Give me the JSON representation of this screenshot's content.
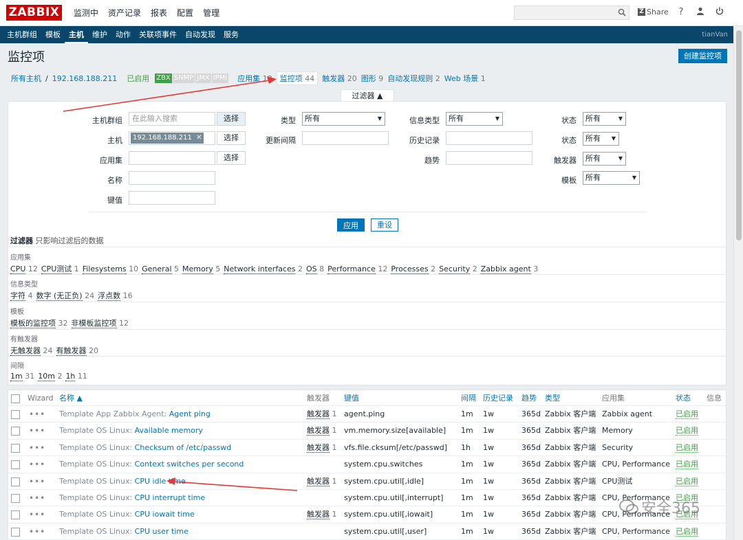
{
  "header": {
    "logo": "ZABBIX",
    "menu": [
      "监测中",
      "资产记录",
      "报表",
      "配置",
      "管理"
    ],
    "selected": "配置",
    "share": "Share",
    "help": "?",
    "user_icon": "user-icon",
    "power_icon": "power-icon"
  },
  "submenu": {
    "items": [
      "主机群组",
      "模板",
      "主机",
      "维护",
      "动作",
      "关联项事件",
      "自动发现",
      "服务"
    ],
    "selected": "主机",
    "user": "tianVan"
  },
  "page": {
    "title": "监控项",
    "create_button": "创建监控项"
  },
  "breadcrumbs": {
    "all_hosts": "所有主机",
    "sep": "/",
    "host": "192.168.188.211",
    "enabled": "已启用",
    "badges": [
      "ZBX",
      "SNMP",
      "JMX",
      "IPMI"
    ],
    "tabs": [
      {
        "label": "应用集",
        "count": "13"
      },
      {
        "label": "监控项",
        "count": "44"
      },
      {
        "label": "触发器",
        "count": "20"
      },
      {
        "label": "图形",
        "count": "9"
      },
      {
        "label": "自动发现规则",
        "count": "2"
      },
      {
        "label": "Web 场景",
        "count": "1"
      }
    ]
  },
  "filter": {
    "tab_label": "过滤器 ▲",
    "host_group_label": "主机群组",
    "host_group_placeholder": "在此输入搜索",
    "select": "选择",
    "host_label": "主机",
    "host_value": "192.168.188.211",
    "host_remove": "✕",
    "app_label": "应用集",
    "name_label": "名称",
    "key_label": "键值",
    "type_label": "类型",
    "type_value": "所有",
    "interval_label": "更新间隔",
    "info_type_label": "信息类型",
    "info_type_value": "所有",
    "history_label": "历史记录",
    "trends_label": "趋势",
    "state_label": "状态",
    "state_value": "所有",
    "status_label": "状态",
    "status_value": "所有",
    "triggers_label": "触发器",
    "triggers_value": "所有",
    "template_label": "模板",
    "template_value": "所有",
    "apply": "应用",
    "reset": "重设",
    "summary_title": "过滤器",
    "summary_desc": "只影响过滤后的数据"
  },
  "subfilters": [
    {
      "title": "应用集",
      "items": [
        {
          "label": "CPU",
          "n": "12"
        },
        {
          "label": "CPU测试",
          "n": "1"
        },
        {
          "label": "Filesystems",
          "n": "10"
        },
        {
          "label": "General",
          "n": "5"
        },
        {
          "label": "Memory",
          "n": "5"
        },
        {
          "label": "Network interfaces",
          "n": "2"
        },
        {
          "label": "OS",
          "n": "8"
        },
        {
          "label": "Performance",
          "n": "12"
        },
        {
          "label": "Processes",
          "n": "2"
        },
        {
          "label": "Security",
          "n": "2"
        },
        {
          "label": "Zabbix agent",
          "n": "3"
        }
      ]
    },
    {
      "title": "信息类型",
      "items": [
        {
          "label": "字符",
          "n": "4"
        },
        {
          "label": "数字 (无正负)",
          "n": "24"
        },
        {
          "label": "浮点数",
          "n": "16"
        }
      ]
    },
    {
      "title": "模板",
      "items": [
        {
          "label": "模板的监控项",
          "n": "32"
        },
        {
          "label": "非模板监控项",
          "n": "12"
        }
      ]
    },
    {
      "title": "有触发器",
      "items": [
        {
          "label": "无触发器",
          "n": "24"
        },
        {
          "label": "有触发器",
          "n": "20"
        }
      ]
    },
    {
      "title": "间隔",
      "items": [
        {
          "label": "1m",
          "n": "31"
        },
        {
          "label": "10m",
          "n": "2"
        },
        {
          "label": "1h",
          "n": "11"
        }
      ]
    }
  ],
  "table": {
    "headers": {
      "wizard": "Wizard",
      "name": "名称 ▲",
      "triggers": "触发器",
      "key": "键值",
      "interval": "间隔",
      "history": "历史记录",
      "trends": "趋势",
      "type": "类型",
      "apps": "应用集",
      "status": "状态",
      "info": "信息"
    },
    "rows": [
      {
        "dots": "•••",
        "tmpl": "Template App Zabbix Agent:",
        "name": "Agent ping",
        "trig": "触发器",
        "trig_n": "1",
        "key": "agent.ping",
        "interval": "1m",
        "history": "1w",
        "trends": "365d",
        "type": "Zabbix 客户端",
        "apps": "Zabbix agent",
        "status": "已启用"
      },
      {
        "dots": "•••",
        "tmpl": "Template OS Linux:",
        "name": "Available memory",
        "trig": "触发器",
        "trig_n": "1",
        "key": "vm.memory.size[available]",
        "interval": "1m",
        "history": "1w",
        "trends": "365d",
        "type": "Zabbix 客户端",
        "apps": "Memory",
        "status": "已启用"
      },
      {
        "dots": "•••",
        "tmpl": "Template OS Linux:",
        "name": "Checksum of /etc/passwd",
        "trig": "触发器",
        "trig_n": "1",
        "key": "vfs.file.cksum[/etc/passwd]",
        "interval": "1h",
        "history": "1w",
        "trends": "365d",
        "type": "Zabbix 客户端",
        "apps": "Security",
        "status": "已启用"
      },
      {
        "dots": "•••",
        "tmpl": "Template OS Linux:",
        "name": "Context switches per second",
        "trig": "",
        "trig_n": "",
        "key": "system.cpu.switches",
        "interval": "1m",
        "history": "1w",
        "trends": "365d",
        "type": "Zabbix 客户端",
        "apps": "CPU, Performance",
        "status": "已启用"
      },
      {
        "dots": "•••",
        "tmpl": "Template OS Linux:",
        "name": "CPU idle time",
        "trig": "触发器",
        "trig_n": "1",
        "key": "system.cpu.util[,idle]",
        "interval": "1m",
        "history": "1w",
        "trends": "365d",
        "type": "Zabbix 客户端",
        "apps": "CPU测试",
        "status": "已启用"
      },
      {
        "dots": "•••",
        "tmpl": "Template OS Linux:",
        "name": "CPU interrupt time",
        "trig": "",
        "trig_n": "",
        "key": "system.cpu.util[,interrupt]",
        "interval": "1m",
        "history": "1w",
        "trends": "365d",
        "type": "Zabbix 客户端",
        "apps": "CPU, Performance",
        "status": "已启用"
      },
      {
        "dots": "•••",
        "tmpl": "Template OS Linux:",
        "name": "CPU iowait time",
        "trig": "触发器",
        "trig_n": "1",
        "key": "system.cpu.util[,iowait]",
        "interval": "1m",
        "history": "1w",
        "trends": "365d",
        "type": "Zabbix 客户端",
        "apps": "CPU, Performance",
        "status": "已启用"
      },
      {
        "dots": "•••",
        "tmpl": "Template OS Linux:",
        "name": "CPU user time",
        "trig": "",
        "trig_n": "",
        "key": "system.cpu.util[,user]",
        "interval": "1m",
        "history": "1w",
        "trends": "365d",
        "type": "Zabbix 客户端",
        "apps": "CPU, Performance",
        "status": "已启用"
      }
    ]
  },
  "watermark": "安全365",
  "colors": {
    "brand": "#d40000",
    "nav": "#0a466a",
    "link": "#0275b8",
    "enabled": "#429e47",
    "annotation": "#e53935"
  }
}
